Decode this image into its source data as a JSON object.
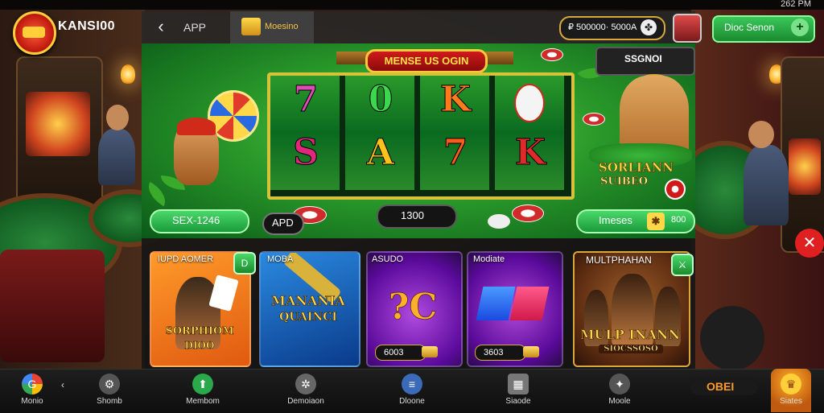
{
  "status_bar": {
    "time": "262 PM"
  },
  "header": {
    "brand": "KANSI00",
    "back_icon": "chevron-left-icon",
    "app_label": "APP",
    "wallet_label": "Moesino",
    "balance": "₽ 500000· 5000A",
    "balance_icon": "clover-icon",
    "deposit_label": "Dioc Senon",
    "deposit_icon": "plus-icon"
  },
  "hero": {
    "banner": "MENSE US OGIN",
    "reels": [
      {
        "top": "7",
        "top_color": "#e04ab8",
        "bottom": "S",
        "bottom_color": "#e0287a"
      },
      {
        "top": "0",
        "top_color": "#3ad84a",
        "bottom": "A",
        "bottom_color": "#ffc21a"
      },
      {
        "top": "K",
        "top_color": "#ff7a1a",
        "bottom": "7",
        "bottom_color": "#ff5a1a"
      },
      {
        "top": "",
        "top_color": "#ffffff",
        "bottom": "K",
        "bottom_color": "#e02a2a"
      }
    ],
    "right_card_label": "SSGNOI",
    "side_brand_title": "SORLIANN",
    "side_brand_sub": "SUIBEO",
    "left_pill": "SEX-1246",
    "apd_pill": "APD",
    "center_pill": "1300",
    "right_pill": "Imeses",
    "right_pill_value": "800"
  },
  "cards": [
    {
      "label": "IUPD AOMER",
      "title": "SORPHIOM",
      "subtitle": "DIOO",
      "price": "",
      "badge_icon": "d-icon",
      "bg": "linear-gradient(160deg,#ff9a2a,#e05a10)"
    },
    {
      "label": "MOBA",
      "title": "MANANIA",
      "subtitle": "QUAINCI",
      "price": "",
      "badge_icon": "",
      "bg": "linear-gradient(160deg,#2a8ae0,#0a3a8a)"
    },
    {
      "label": "ASUDO",
      "title": "?C",
      "subtitle": "",
      "price": "6003",
      "badge_icon": "",
      "bg": "radial-gradient(circle at 50% 55%,#b04ae0,#5a0a9a 70%,#2a0a4a)"
    },
    {
      "label": "Modiate",
      "title": "",
      "subtitle": "",
      "price": "3603",
      "badge_icon": "",
      "bg": "radial-gradient(circle at 50% 50%,#b04ad8,#5a0a9a 70%,#2a0a4a)"
    },
    {
      "label": "MULTPHAHAN",
      "title": "MULP INANN",
      "subtitle": "SIOCSSOSO",
      "price": "",
      "badge_icon": "swords-icon",
      "bg": "radial-gradient(circle at 50% 45%,#a0602a,#5a2a10 70%,#2a1208)"
    }
  ],
  "nav": [
    {
      "label": "Monio",
      "icon": "google-g-icon"
    },
    {
      "label": "Shomb",
      "icon": "gear-icon"
    },
    {
      "label": "Membom",
      "icon": "upload-icon"
    },
    {
      "label": "Demoiaon",
      "icon": "settings-icon"
    },
    {
      "label": "Dloone",
      "icon": "list-icon"
    },
    {
      "label": "Siaode",
      "icon": "calendar-icon"
    },
    {
      "label": "Moole",
      "icon": "chat-icon"
    },
    {
      "label": "Siates",
      "icon": "crown-icon"
    }
  ],
  "nav_promo": "OBEI",
  "colors": {
    "accent_green": "#2aa84a",
    "gold": "#ffd84a",
    "panel_dark": "#141414"
  }
}
